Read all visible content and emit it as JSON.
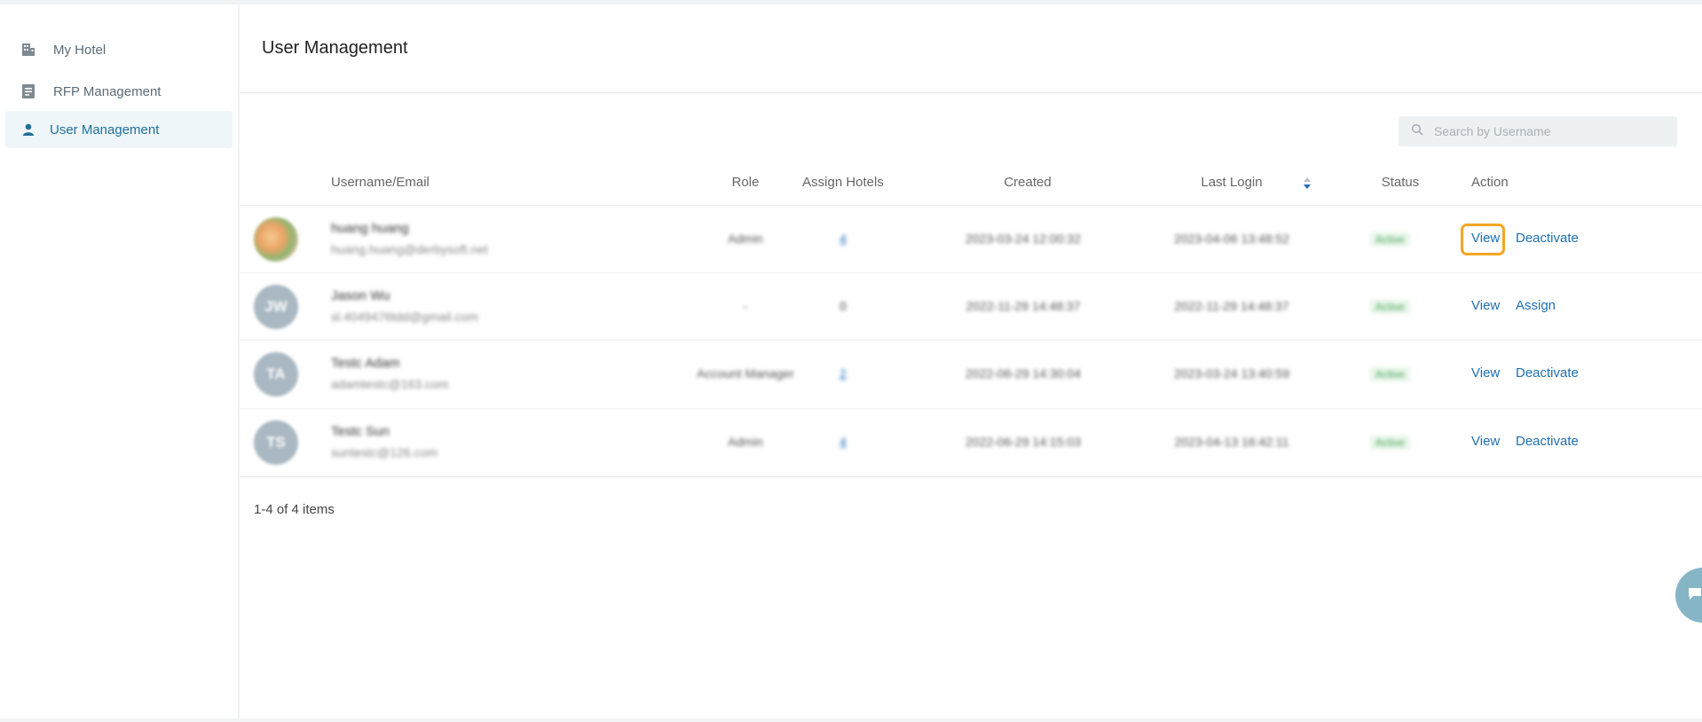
{
  "sidebar": {
    "items": [
      {
        "label": "My Hotel",
        "icon": "building-icon"
      },
      {
        "label": "RFP Management",
        "icon": "document-icon"
      },
      {
        "label": "User Management",
        "icon": "user-icon",
        "active": true
      }
    ]
  },
  "main": {
    "title": "User Management",
    "search": {
      "placeholder": "Search by Username",
      "value": ""
    },
    "table": {
      "columns": [
        "Username/Email",
        "Role",
        "Assign Hotels",
        "Created",
        "Last Login",
        "Status",
        "Action"
      ],
      "sorted_column": "Created",
      "rows": [
        {
          "initials": "",
          "avatar": "photo",
          "name": "huang huang",
          "email": "huang.huang@derbysoft.net",
          "role": "Admin",
          "hotels": "4",
          "hotels_link": true,
          "created": "2023-03-24 12:00:32",
          "last_login": "2023-04-06 13:48:52",
          "status": "Active",
          "actions": [
            "View",
            "Deactivate"
          ]
        },
        {
          "initials": "JW",
          "avatar": "initials",
          "name": "Jason Wu",
          "email": "sl.4049476tdd@gmail.com",
          "role": "-",
          "hotels": "0",
          "hotels_link": false,
          "created": "2022-11-29 14:48:37",
          "last_login": "2022-11-29 14:48:37",
          "status": "Active",
          "actions": [
            "View",
            "Assign"
          ]
        },
        {
          "initials": "TA",
          "avatar": "initials",
          "name": "Testc Adam",
          "email": "adamtestc@163.com",
          "role": "Account Manager",
          "hotels": "2",
          "hotels_link": true,
          "created": "2022-06-29 14:30:04",
          "last_login": "2023-03-24 13:40:59",
          "status": "Active",
          "actions": [
            "View",
            "Deactivate"
          ]
        },
        {
          "initials": "TS",
          "avatar": "initials",
          "name": "Testc Sun",
          "email": "suntestc@126.com",
          "role": "Admin",
          "hotels": "4",
          "hotels_link": true,
          "created": "2022-06-29 14:15:03",
          "last_login": "2023-04-13 16:42:11",
          "status": "Active",
          "actions": [
            "View",
            "Deactivate"
          ]
        }
      ]
    },
    "pagination": {
      "summary": "1-4 of 4 items"
    }
  },
  "colors": {
    "link": "#1f6fb0",
    "active_nav_bg": "#eef6f9",
    "focus_ring": "#f5a623",
    "status_active": "#4aa35a"
  }
}
